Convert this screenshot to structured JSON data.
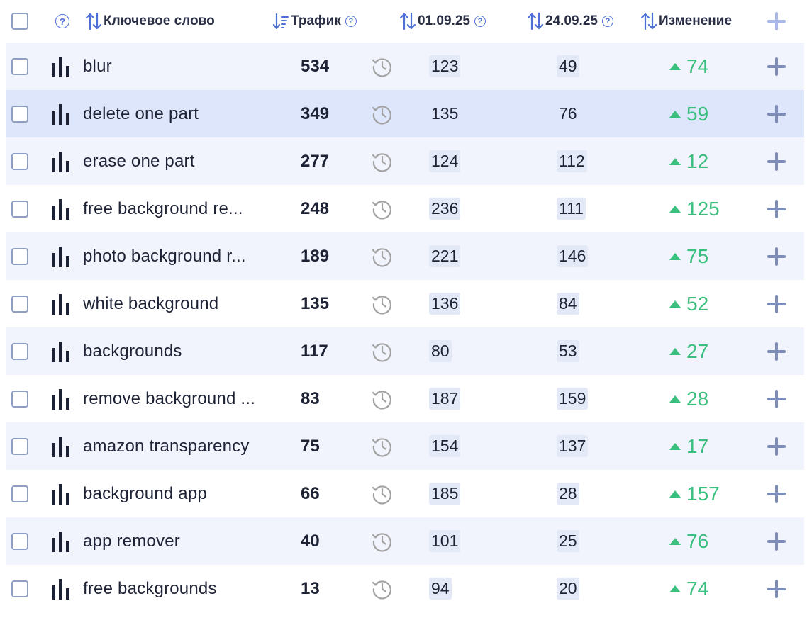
{
  "header": {
    "keyword_label": "Ключевое слово",
    "traffic_label": "Трафик",
    "date1_label": "01.09.25",
    "date2_label": "24.09.25",
    "change_label": "Изменение",
    "help_glyph": "?"
  },
  "icons": {
    "select_all": "checkbox-icon",
    "help": "question-circle-icon",
    "sort": "sort-arrows-icon",
    "chart": "bar-chart-icon",
    "history": "history-clock-icon",
    "add": "plus-icon",
    "up": "triangle-up-icon"
  },
  "colors": {
    "accent": "#4c6fd8",
    "positive": "#3bbf7e",
    "row_alt": "#f1f4fc",
    "row_highlight": "#dde6fb",
    "pill": "#e3e9f7"
  },
  "rows": [
    {
      "keyword": "blur",
      "traffic": "534",
      "d1": "123",
      "d2": "49",
      "change": "74"
    },
    {
      "keyword": "delete one part",
      "traffic": "349",
      "d1": "135",
      "d2": "76",
      "change": "59"
    },
    {
      "keyword": "erase one part",
      "traffic": "277",
      "d1": "124",
      "d2": "112",
      "change": "12"
    },
    {
      "keyword": "free background re...",
      "traffic": "248",
      "d1": "236",
      "d2": "111",
      "change": "125"
    },
    {
      "keyword": "photo background r...",
      "traffic": "189",
      "d1": "221",
      "d2": "146",
      "change": "75"
    },
    {
      "keyword": "white background",
      "traffic": "135",
      "d1": "136",
      "d2": "84",
      "change": "52"
    },
    {
      "keyword": "backgrounds",
      "traffic": "117",
      "d1": "80",
      "d2": "53",
      "change": "27"
    },
    {
      "keyword": "remove background ...",
      "traffic": "83",
      "d1": "187",
      "d2": "159",
      "change": "28"
    },
    {
      "keyword": "amazon transparency",
      "traffic": "75",
      "d1": "154",
      "d2": "137",
      "change": "17"
    },
    {
      "keyword": "background app",
      "traffic": "66",
      "d1": "185",
      "d2": "28",
      "change": "157"
    },
    {
      "keyword": "app remover",
      "traffic": "40",
      "d1": "101",
      "d2": "25",
      "change": "76"
    },
    {
      "keyword": "free backgrounds",
      "traffic": "13",
      "d1": "94",
      "d2": "20",
      "change": "74"
    }
  ]
}
